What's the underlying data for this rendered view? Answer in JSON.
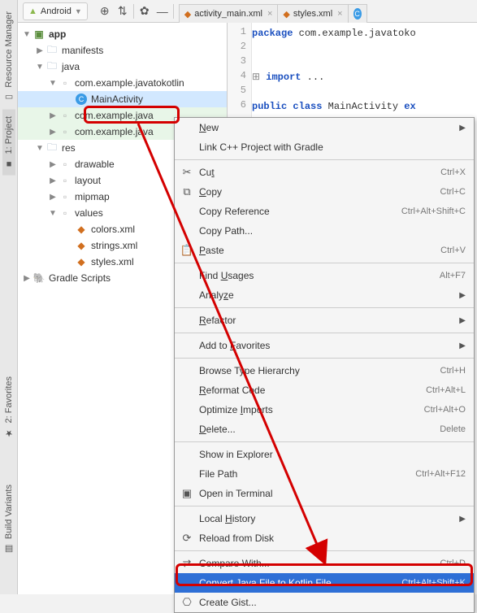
{
  "sidebar_tabs": {
    "resource_manager": "Resource Manager",
    "project": "1: Project",
    "favorites": "2: Favorites",
    "build_variants": "Build Variants"
  },
  "topbar": {
    "platform_selector": "Android"
  },
  "editor_tabs": [
    {
      "label": "activity_main.xml"
    },
    {
      "label": "styles.xml"
    }
  ],
  "code": {
    "line1_kw": "package",
    "line1_rest": " com.example.javatoko",
    "line4_kw": "import",
    "line4_rest": " ...",
    "line6a": "public",
    "line6b": " class",
    "line6c": " MainActivity ",
    "line6d": "ex"
  },
  "gutter": [
    "1",
    "2",
    "3",
    "4",
    "5",
    "6"
  ],
  "tree": {
    "app": "app",
    "manifests": "manifests",
    "java": "java",
    "pkg1": "com.example.javatokotlin",
    "main_activity": "MainActivity",
    "pkg2": "com.example.java",
    "pkg3": "com.example.java",
    "res": "res",
    "drawable": "drawable",
    "layout": "layout",
    "mipmap": "mipmap",
    "values": "values",
    "colors": "colors.xml",
    "strings": "strings.xml",
    "styles": "styles.xml",
    "gradle": "Gradle Scripts"
  },
  "context_menu": {
    "items": [
      {
        "type": "item",
        "label": "New",
        "under": "N",
        "submenu": true
      },
      {
        "type": "item",
        "label": "Link C++ Project with Gradle"
      },
      {
        "type": "sep"
      },
      {
        "type": "item",
        "icon": "✂",
        "label": "Cut",
        "under": "t",
        "shortcut": "Ctrl+X"
      },
      {
        "type": "item",
        "icon": "⧉",
        "label": "Copy",
        "under": "C",
        "shortcut": "Ctrl+C"
      },
      {
        "type": "item",
        "label": "Copy Reference",
        "shortcut": "Ctrl+Alt+Shift+C"
      },
      {
        "type": "item",
        "label": "Copy Path...",
        "under": ""
      },
      {
        "type": "item",
        "icon": "📋",
        "label": "Paste",
        "under": "P",
        "shortcut": "Ctrl+V"
      },
      {
        "type": "sep"
      },
      {
        "type": "item",
        "label": "Find Usages",
        "under": "U",
        "shortcut": "Alt+F7"
      },
      {
        "type": "item",
        "label": "Analyze",
        "under": "z",
        "submenu": true
      },
      {
        "type": "sep"
      },
      {
        "type": "item",
        "label": "Refactor",
        "under": "R",
        "submenu": true
      },
      {
        "type": "sep"
      },
      {
        "type": "item",
        "label": "Add to Favorites",
        "under": "F",
        "submenu": true
      },
      {
        "type": "sep"
      },
      {
        "type": "item",
        "label": "Browse Type Hierarchy",
        "shortcut": "Ctrl+H"
      },
      {
        "type": "item",
        "label": "Reformat Code",
        "under": "R",
        "shortcut": "Ctrl+Alt+L"
      },
      {
        "type": "item",
        "label": "Optimize Imports",
        "under": "I",
        "shortcut": "Ctrl+Alt+O"
      },
      {
        "type": "item",
        "label": "Delete...",
        "under": "D",
        "shortcut": "Delete"
      },
      {
        "type": "sep"
      },
      {
        "type": "item",
        "label": "Show in Explorer"
      },
      {
        "type": "item",
        "label": "File Path",
        "shortcut": "Ctrl+Alt+F12"
      },
      {
        "type": "item",
        "icon": "▣",
        "label": "Open in Terminal",
        "under": ""
      },
      {
        "type": "sep"
      },
      {
        "type": "item",
        "label": "Local History",
        "under": "H",
        "submenu": true
      },
      {
        "type": "item",
        "icon": "⟳",
        "label": "Reload from Disk",
        "under": ""
      },
      {
        "type": "sep"
      },
      {
        "type": "item",
        "icon": "⇄",
        "label": "Compare With...",
        "under": "",
        "shortcut": "Ctrl+D"
      },
      {
        "type": "item",
        "label": "Convert Java File to Kotlin File",
        "shortcut": "Ctrl+Alt+Shift+K",
        "highlight": true
      },
      {
        "type": "item",
        "icon": "⎔",
        "label": "Create Gist...",
        "under": ""
      }
    ]
  }
}
